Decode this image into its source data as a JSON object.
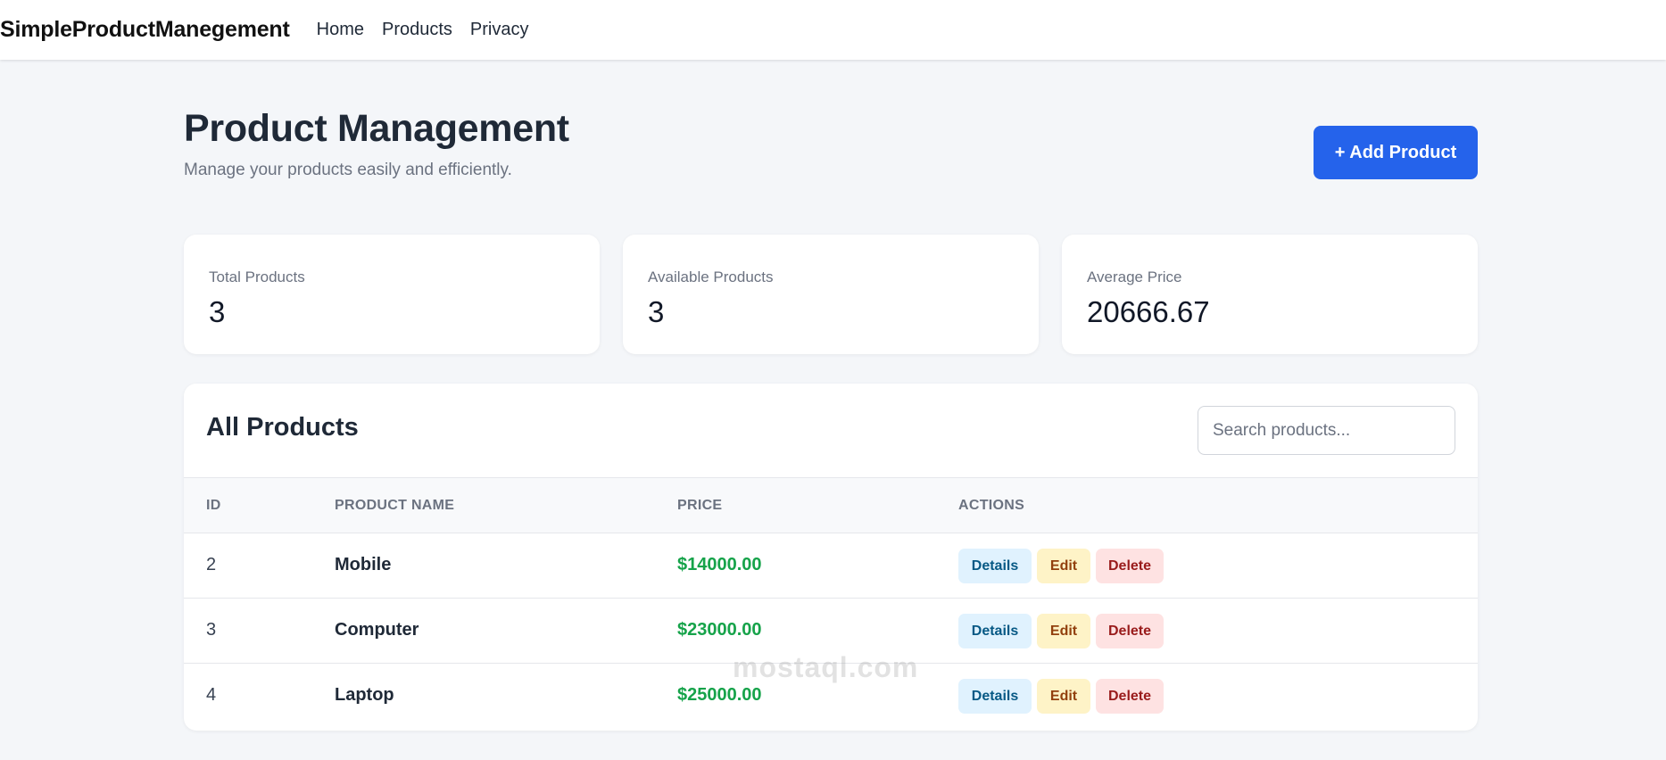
{
  "navbar": {
    "brand": "SimpleProductManegement",
    "links": [
      "Home",
      "Products",
      "Privacy"
    ]
  },
  "header": {
    "title": "Product Management",
    "subtitle": "Manage your products easily and efficiently.",
    "add_button": "+ Add Product"
  },
  "stats": [
    {
      "label": "Total Products",
      "value": "3"
    },
    {
      "label": "Available Products",
      "value": "3"
    },
    {
      "label": "Average Price",
      "value": "20666.67"
    }
  ],
  "products_panel": {
    "title": "All Products",
    "search_placeholder": "Search products...",
    "columns": [
      "ID",
      "PRODUCT NAME",
      "PRICE",
      "ACTIONS"
    ],
    "rows": [
      {
        "id": "2",
        "name": "Mobile",
        "price": "$14000.00"
      },
      {
        "id": "3",
        "name": "Computer",
        "price": "$23000.00"
      },
      {
        "id": "4",
        "name": "Laptop",
        "price": "$25000.00"
      }
    ],
    "actions": {
      "details": "Details",
      "edit": "Edit",
      "delete": "Delete"
    }
  },
  "watermark": "mostaql.com",
  "colors": {
    "primary": "#2563eb",
    "price": "#16a34a",
    "details_bg": "#e0f2fe",
    "edit_bg": "#fef3c7",
    "delete_bg": "#fee2e2"
  }
}
